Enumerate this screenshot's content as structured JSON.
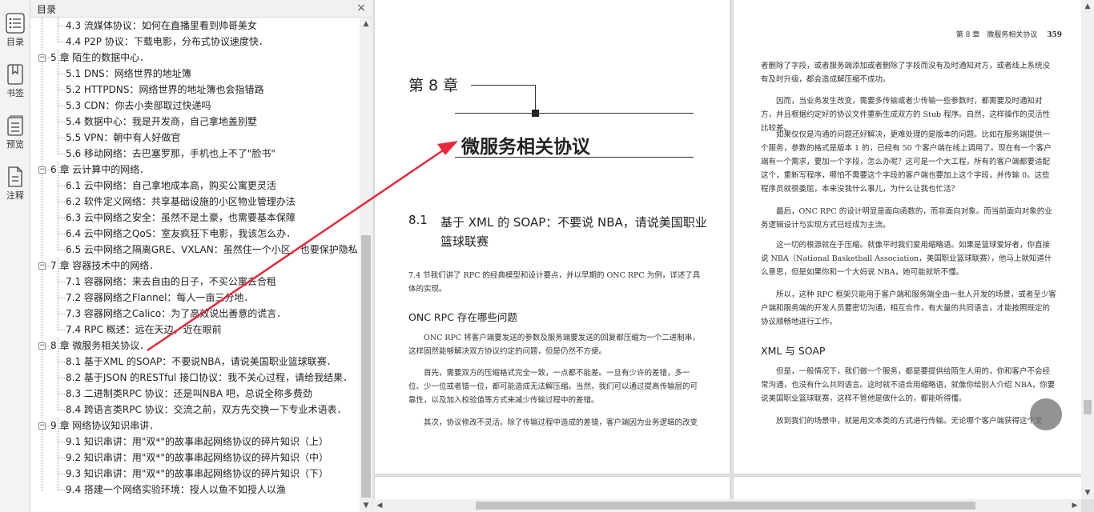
{
  "rail": {
    "items": [
      {
        "label": "目录",
        "icon": "list-icon"
      },
      {
        "label": "书签",
        "icon": "bookmark-icon"
      },
      {
        "label": "预览",
        "icon": "preview-icon"
      },
      {
        "label": "注释",
        "icon": "annotation-icon"
      }
    ]
  },
  "toc": {
    "title": "目录",
    "close": "×",
    "rows": [
      {
        "text": "4.3 流媒体协议：如何在直播里看到帅哥美女",
        "level": 2
      },
      {
        "text": "4.4 P2P 协议：下载电影，分布式协议速度快．",
        "level": 2
      },
      {
        "text": "5 章 陌生的数据中心．",
        "level": 1,
        "toggle": "−"
      },
      {
        "text": "5.1 DNS：网络世界的地址簿",
        "level": 2
      },
      {
        "text": "5.2 HTTPDNS：网络世界的地址簿也会指错路",
        "level": 2
      },
      {
        "text": "5.3 CDN：你去小卖部取过快递吗",
        "level": 2
      },
      {
        "text": "5.4 数据中心：我是开发商，自己拿地盖别墅",
        "level": 2
      },
      {
        "text": "5.5 VPN：朝中有人好做官",
        "level": 2
      },
      {
        "text": "5.6 移动网络：去巴塞罗那，手机也上不了\"脸书\"",
        "level": 2
      },
      {
        "text": "6 章 云计算中的网络．",
        "level": 1,
        "toggle": "−"
      },
      {
        "text": "6.1 云中网络：自己拿地成本高，购买公寓更灵活",
        "level": 2
      },
      {
        "text": "6.2 软件定义网络：共享基础设施的小区物业管理办法",
        "level": 2
      },
      {
        "text": "6.3 云中网络之安全：虽然不是土豪，也需要基本保障",
        "level": 2
      },
      {
        "text": "6.4 云中网络之QoS：室友疯狂下电影，我该怎么办．",
        "level": 2
      },
      {
        "text": "6.5 云中网络之隔离GRE、VXLAN：虽然住一个小区，也要保护隐私",
        "level": 2
      },
      {
        "text": "7 章 容器技术中的网络．",
        "level": 1,
        "toggle": "−"
      },
      {
        "text": "7.1 容器网络：来去自由的日子，不买公寓去合租",
        "level": 2
      },
      {
        "text": "7.2 容器网络之Flannel：每人一亩三分地．",
        "level": 2
      },
      {
        "text": "7.3 容器网络之Calico：为了高效说出善意的谎言．",
        "level": 2
      },
      {
        "text": "7.4 RPC 概述：远在天边，近在眼前",
        "level": 2
      },
      {
        "text": "8 章 微服务相关协议．",
        "level": 1,
        "toggle": "−",
        "selected": true
      },
      {
        "text": "8.1 基于XML 的SOAP：不要说NBA，请说美国职业篮球联赛．",
        "level": 2
      },
      {
        "text": "8.2 基于JSON 的RESTful 接口协议：我不关心过程，请给我结果．",
        "level": 2
      },
      {
        "text": "8.3 二进制类RPC 协议：还是叫NBA 吧，总说全称多费劲",
        "level": 2
      },
      {
        "text": "8.4 跨语言类RPC 协议：交流之前，双方先交换一下专业术语表．",
        "level": 2
      },
      {
        "text": "9 章 网络协议知识串讲．",
        "level": 1,
        "toggle": "−"
      },
      {
        "text": "9.1 知识串讲：用\"双*\"的故事串起网络协议的碎片知识（上）",
        "level": 2
      },
      {
        "text": "9.2 知识串讲：用\"双*\"的故事串起网络协议的碎片知识（中）",
        "level": 2
      },
      {
        "text": "9.3 知识串讲：用\"双*\"的故事串起网络协议的碎片知识（下）",
        "level": 2
      },
      {
        "text": "9.4 搭建一个网络实验环境：授人以鱼不如授人以渔",
        "level": 2
      }
    ]
  },
  "left_page": {
    "chapter_num": "第 8 章",
    "chapter_title": "微服务相关协议",
    "section_num": "8.1",
    "section_title": "基于 XML 的 SOAP：不要说 NBA，请说美国职业篮球联赛",
    "intro": "7.4 节我们讲了 RPC 的经典模型和设计要点，并以早期的 ONC RPC 为例，详述了具体的实现。",
    "subheading": "ONC RPC 存在哪些问题",
    "p1": "ONC RPC 将客户端要发送的参数及服务端要发送的回复都压缩为一个二进制串，这样固然能够解决双方协议约定的问题，但是仍然不方便。",
    "p2": "首先，需要双方的压缩格式完全一致，一点都不能差。一旦有少许的差错，多一位、少一位或者错一位，都可能造成无法解压缩。当然，我们可以通过提高传输层的可靠性，以及加入校验值等方式来减少传输过程中的差错。",
    "p3": "其次，协议修改不灵活。除了传输过程中造成的差错，客户端因为业务逻辑的改变添加或"
  },
  "right_page": {
    "header_chapter": "第 8 章　微服务相关协议",
    "page_number": "359",
    "p1": "者删除了字段，或者服务端添加或者删除了字段而没有及时通知对方，或者线上系统没有及时升级，都会造成解压缩不成功。",
    "p2": "因而，当业务发生改变，需要多传输或者少传输一些参数时，都需要及时通知对方，并且根据约定好的协议文件重新生成双方的 Stub 程序。自然，这样操作的灵活性比较差。",
    "p3": "如果仅仅是沟通的问题还好解决，更难处理的是版本的问题。比如在服务端提供一个服务，参数的格式是版本 1 的，已经有 50 个客户端在线上调用了。现在有一个客户端有一个需求，要加一个字段，怎么办呢？这可是一个大工程，所有的客户端都要适配这个，重新写程序，哪怕不需要这个字段的客户端也要加上这个字段，并传输 0。这些程序员就很委屈，本来没我什么事儿，为什么让我也忙活？",
    "p4": "最后，ONC RPC 的设计明显是面向函数的，而非面向对象。而当前面向对象的业务逻辑设计与实现方式已经成为主流。",
    "p5": "这一切的根源就在于压缩。就像平时我们爱用缩略语。如果是篮球爱好者，你直接说 NBA（National Basketball Association，美国职业篮球联赛），他马上就知道什么意思，但是如果你和一个大妈说 NBA，她可能就听不懂。",
    "p6": "所以，这种 RPC 框架只能用于客户端和服务端全由一批人开发的场景，或者至少客户端和服务端的开发人员要密切沟通，相互合作，有大量的共同语言，才能按照既定的协议顺畅地进行工作。",
    "subheading": "XML 与 SOAP",
    "p7": "但是，一般情况下，我们做一个服务，都是要提供给陌生人用的，你和客户不会经常沟通，也没有什么共同语言。这时就不适合用缩略语，就像你给别人介绍 NBA，你要说美国职业篮球联赛，这样不管他是做什么的，都能听得懂。",
    "p8": "放到我们的场景中，就是用文本类的方式进行传输。无论哪个客户端获得这个文本，都能"
  },
  "colors": {
    "arrow": "#e8283a",
    "fab": "#6e6e6e"
  }
}
